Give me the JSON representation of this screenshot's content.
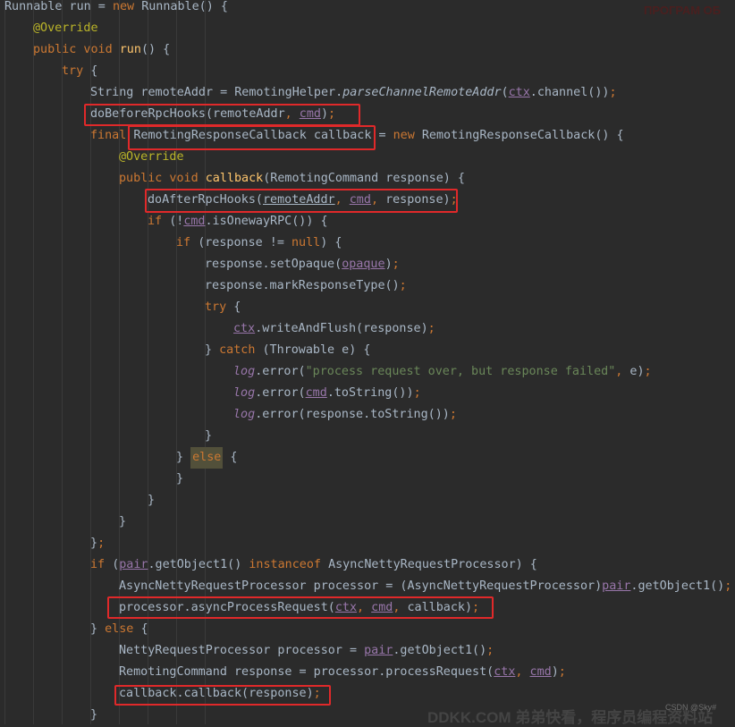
{
  "code_lines": [
    {
      "indent": 0,
      "tokens": [
        [
          "tx",
          "Runnable run = "
        ],
        [
          "kw",
          "new "
        ],
        [
          "tx",
          "Runnable() {"
        ]
      ]
    },
    {
      "indent": 1,
      "tokens": [
        [
          "ann",
          "@Override"
        ]
      ]
    },
    {
      "indent": 1,
      "tokens": [
        [
          "kw",
          "public void "
        ],
        [
          "fn",
          "run"
        ],
        [
          "tx",
          "() {"
        ]
      ]
    },
    {
      "indent": 2,
      "tokens": [
        [
          "kw",
          "try "
        ],
        [
          "tx",
          "{"
        ]
      ]
    },
    {
      "indent": 3,
      "tokens": [
        [
          "tx",
          "String remoteAddr = RemotingHelper."
        ],
        [
          "it",
          "parseChannelRemoteAddr"
        ],
        [
          "tx",
          "("
        ],
        [
          "fld ul",
          "ctx"
        ],
        [
          "tx",
          ".channel())"
        ],
        [
          "kw",
          ";"
        ]
      ]
    },
    {
      "indent": 3,
      "tokens": [
        [
          "tx",
          "doBeforeRpcHooks(remoteAddr"
        ],
        [
          "kw",
          ", "
        ],
        [
          "fld ul",
          "cmd"
        ],
        [
          "tx",
          ")"
        ],
        [
          "kw",
          ";"
        ]
      ]
    },
    {
      "indent": 3,
      "tokens": [
        [
          "kw",
          "final "
        ],
        [
          "tx",
          "RemotingResponseCallback callback = "
        ],
        [
          "kw",
          "new "
        ],
        [
          "tx",
          "RemotingResponseCallback() {"
        ]
      ]
    },
    {
      "indent": 4,
      "tokens": [
        [
          "ann",
          "@Override"
        ]
      ]
    },
    {
      "indent": 4,
      "tokens": [
        [
          "kw",
          "public void "
        ],
        [
          "fn",
          "callback"
        ],
        [
          "tx",
          "(RemotingCommand response) {"
        ]
      ]
    },
    {
      "indent": 5,
      "tokens": [
        [
          "tx",
          "doAfterRpcHooks("
        ],
        [
          "ul",
          "remoteAddr"
        ],
        [
          "kw",
          ", "
        ],
        [
          "fld ul",
          "cmd"
        ],
        [
          "kw",
          ", "
        ],
        [
          "tx",
          "response)"
        ],
        [
          "kw",
          ";"
        ]
      ]
    },
    {
      "indent": 5,
      "tokens": [
        [
          "kw",
          "if "
        ],
        [
          "tx",
          "(!"
        ],
        [
          "fld ul",
          "cmd"
        ],
        [
          "tx",
          ".isOnewayRPC()) {"
        ]
      ]
    },
    {
      "indent": 6,
      "tokens": [
        [
          "kw",
          "if "
        ],
        [
          "tx",
          "(response != "
        ],
        [
          "kw",
          "null"
        ],
        [
          "tx",
          ") {"
        ]
      ]
    },
    {
      "indent": 7,
      "tokens": [
        [
          "tx",
          "response.setOpaque("
        ],
        [
          "fld ul",
          "opaque"
        ],
        [
          "tx",
          ")"
        ],
        [
          "kw",
          ";"
        ]
      ]
    },
    {
      "indent": 7,
      "tokens": [
        [
          "tx",
          "response.markResponseType()"
        ],
        [
          "kw",
          ";"
        ]
      ]
    },
    {
      "indent": 7,
      "tokens": [
        [
          "kw",
          "try "
        ],
        [
          "tx",
          "{"
        ]
      ]
    },
    {
      "indent": 8,
      "tokens": [
        [
          "fld ul",
          "ctx"
        ],
        [
          "tx",
          ".writeAndFlush(response)"
        ],
        [
          "kw",
          ";"
        ]
      ]
    },
    {
      "indent": 7,
      "tokens": [
        [
          "tx",
          "} "
        ],
        [
          "kw",
          "catch "
        ],
        [
          "tx",
          "(Throwable e) {"
        ]
      ]
    },
    {
      "indent": 8,
      "tokens": [
        [
          "fld it",
          "log"
        ],
        [
          "tx",
          ".error("
        ],
        [
          "str",
          "\"process request over, but response failed\""
        ],
        [
          "kw",
          ", "
        ],
        [
          "tx",
          "e)"
        ],
        [
          "kw",
          ";"
        ]
      ]
    },
    {
      "indent": 8,
      "tokens": [
        [
          "fld it",
          "log"
        ],
        [
          "tx",
          ".error("
        ],
        [
          "fld ul",
          "cmd"
        ],
        [
          "tx",
          ".toString())"
        ],
        [
          "kw",
          ";"
        ]
      ]
    },
    {
      "indent": 8,
      "tokens": [
        [
          "fld it",
          "log"
        ],
        [
          "tx",
          ".error(response.toString())"
        ],
        [
          "kw",
          ";"
        ]
      ]
    },
    {
      "indent": 7,
      "tokens": [
        [
          "tx",
          "}"
        ]
      ]
    },
    {
      "indent": 6,
      "tokens": [
        [
          "tx",
          "} "
        ],
        [
          "kw elsebg",
          "else"
        ],
        [
          "tx",
          " {"
        ]
      ]
    },
    {
      "indent": 6,
      "tokens": [
        [
          "tx",
          "}"
        ]
      ]
    },
    {
      "indent": 5,
      "tokens": [
        [
          "tx",
          "}"
        ]
      ]
    },
    {
      "indent": 4,
      "tokens": [
        [
          "tx",
          "}"
        ]
      ]
    },
    {
      "indent": 3,
      "tokens": [
        [
          "tx",
          "}"
        ],
        [
          "kw",
          ";"
        ]
      ]
    },
    {
      "indent": 3,
      "tokens": [
        [
          "kw",
          "if "
        ],
        [
          "tx",
          "("
        ],
        [
          "fld ul",
          "pair"
        ],
        [
          "tx",
          ".getObject1() "
        ],
        [
          "kw",
          "instanceof "
        ],
        [
          "tx",
          "AsyncNettyRequestProcessor) {"
        ]
      ]
    },
    {
      "indent": 4,
      "tokens": [
        [
          "tx",
          "AsyncNettyRequestProcessor processor = (AsyncNettyRequestProcessor)"
        ],
        [
          "fld ul",
          "pair"
        ],
        [
          "tx",
          ".getObject1()"
        ],
        [
          "kw",
          ";"
        ]
      ]
    },
    {
      "indent": 4,
      "tokens": [
        [
          "tx",
          "processor.asyncProcessRequest("
        ],
        [
          "fld ul",
          "ctx"
        ],
        [
          "kw",
          ", "
        ],
        [
          "fld ul",
          "cmd"
        ],
        [
          "kw",
          ", "
        ],
        [
          "tx",
          "callback)"
        ],
        [
          "kw",
          ";"
        ]
      ]
    },
    {
      "indent": 3,
      "tokens": [
        [
          "tx",
          "} "
        ],
        [
          "kw",
          "else "
        ],
        [
          "tx",
          "{"
        ]
      ]
    },
    {
      "indent": 4,
      "tokens": [
        [
          "tx",
          "NettyRequestProcessor processor = "
        ],
        [
          "fld ul",
          "pair"
        ],
        [
          "tx",
          ".getObject1()"
        ],
        [
          "kw",
          ";"
        ]
      ]
    },
    {
      "indent": 4,
      "tokens": [
        [
          "tx",
          "RemotingCommand response = processor.processRequest("
        ],
        [
          "fld ul",
          "ctx"
        ],
        [
          "kw",
          ", "
        ],
        [
          "fld ul",
          "cmd"
        ],
        [
          "tx",
          ")"
        ],
        [
          "kw",
          ";"
        ]
      ]
    },
    {
      "indent": 4,
      "tokens": [
        [
          "tx",
          "callback.callback(response)"
        ],
        [
          "kw",
          ";"
        ]
      ]
    },
    {
      "indent": 3,
      "tokens": [
        [
          "tx",
          "}"
        ]
      ]
    }
  ],
  "watermarks": {
    "top_right": "ПРОГРАМ ОБ",
    "bottom": "DDKK.COM 弟弟快看，程序员编程资料站",
    "bottom_small": "CSDN @Sky#"
  },
  "colors": {
    "background": "#2b2b2b",
    "keyword": "#cc7832",
    "annotation": "#bbb529",
    "method_declaration": "#ffc66d",
    "string": "#6a8759",
    "field": "#9876aa",
    "plain": "#a9b7c6",
    "highlight_box": "#e0292a"
  }
}
